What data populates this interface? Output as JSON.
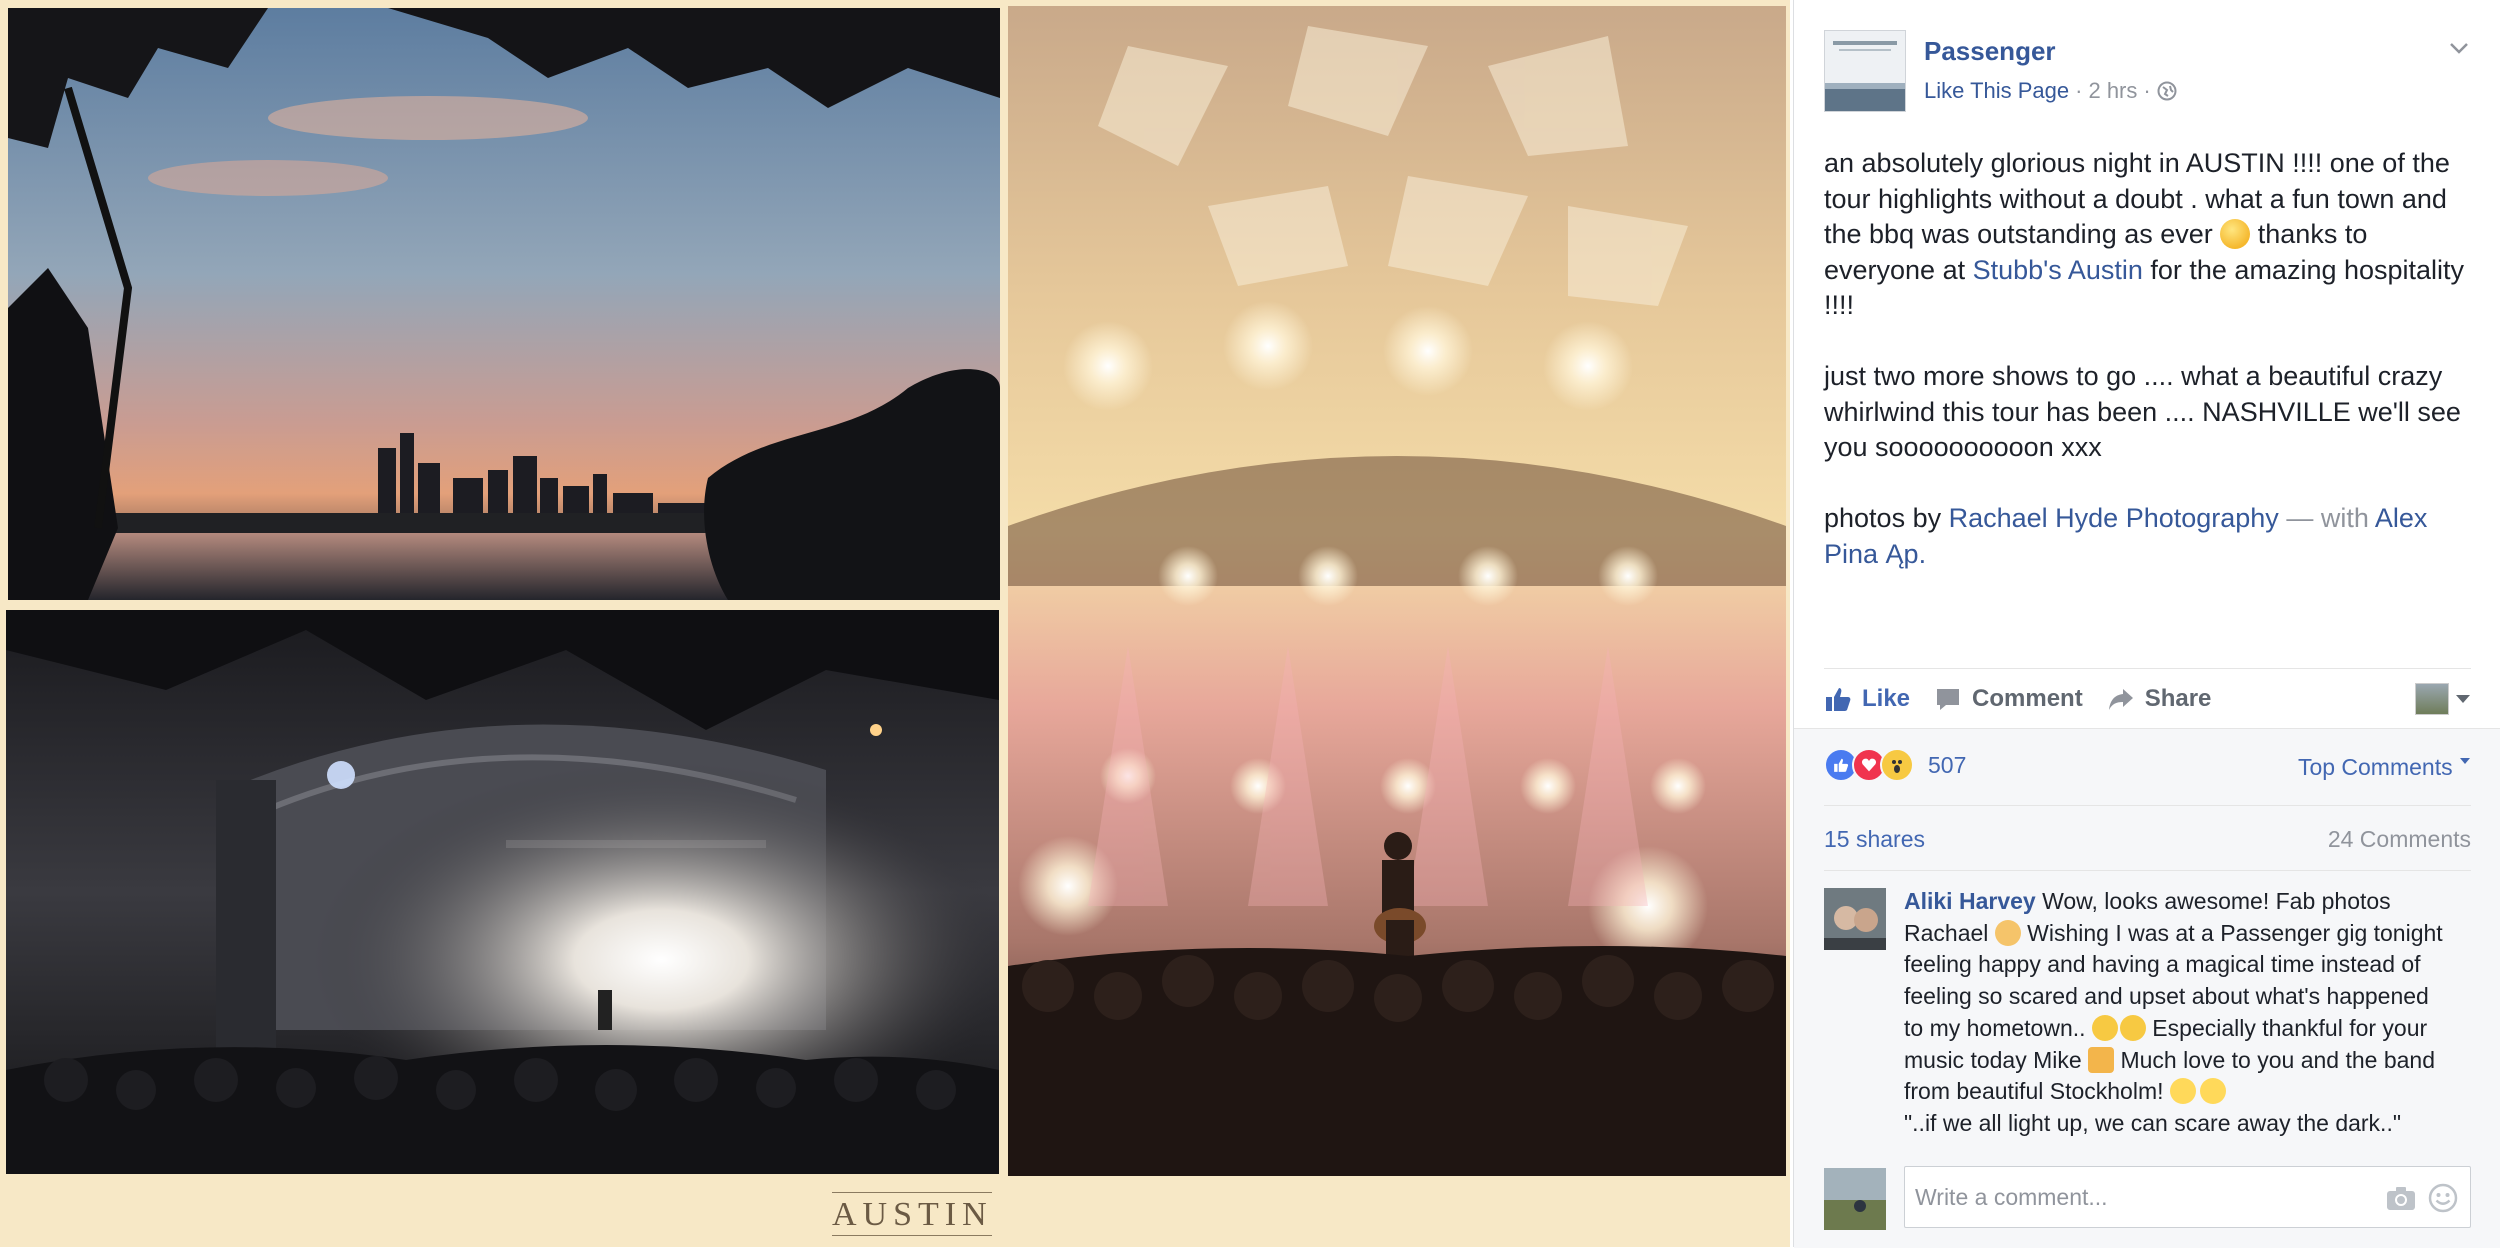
{
  "collage": {
    "caption": "AUSTIN"
  },
  "post": {
    "page_name": "Passenger",
    "like_page": "Like This Page",
    "separator": "·",
    "time": "2 hrs",
    "audience_icon": "globe-icon",
    "para1_part1": "an absolutely glorious night in AUSTIN !!!! one of the tour highlights without a doubt . what a fun town and the bbq was outstanding as ever ",
    "para1_part2": " thanks to everyone at ",
    "para1_link": "Stubb's Austin",
    "para1_part3": " for the amazing hospitality !!!!",
    "para2": "just two more shows to go .... what a beautiful crazy whirlwind this tour has been .... NASHVILLE we'll see you soooooooooon xxx",
    "para3_prefix": "photos by ",
    "para3_link1": "Rachael Hyde Photography",
    "para3_with": " — with ",
    "para3_link2": "Alex Pina Ąp."
  },
  "actions": {
    "like": "Like",
    "comment": "Comment",
    "share": "Share"
  },
  "stats": {
    "reactions_count": "507",
    "reaction_types": [
      "like",
      "love",
      "wow"
    ],
    "sort_label": "Top Comments",
    "shares": "15 shares",
    "comments": "24 Comments"
  },
  "comment": {
    "author": "Aliki Harvey",
    "text1": " Wow, looks awesome! Fab photos Rachael ",
    "text2": " Wishing I was at a Passenger gig tonight feeling happy and having a magical time instead of feeling so scared and upset about what's happened to my hometown.. ",
    "text3": " Especially thankful for your music today Mike ",
    "text4": " Much love to you and the band from beautiful Stockholm! ",
    "text5": "\"..if we all light up, we can scare away the dark..\""
  },
  "composer": {
    "placeholder": "Write a comment..."
  },
  "colors": {
    "link": "#365899",
    "action_blue": "#4267b2",
    "muted": "#90949c",
    "text": "#1d2129",
    "collage_bg": "#f7e8c6"
  }
}
